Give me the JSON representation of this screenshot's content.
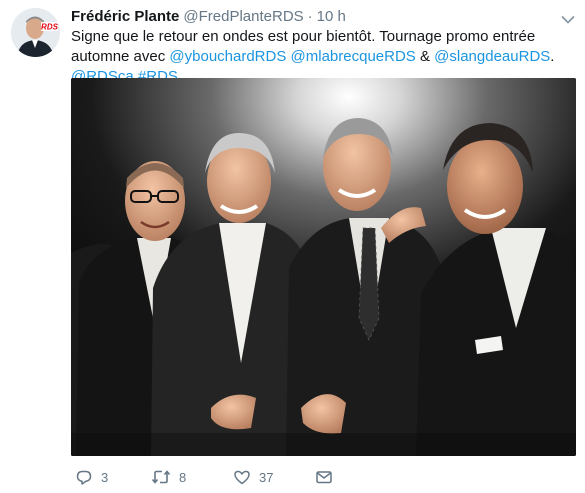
{
  "tweet": {
    "author_name": "Frédéric Plante",
    "handle": "@FredPlanteRDS",
    "separator": "·",
    "time": "10 h",
    "text_plain_1": "Signe que le retour en ondes est pour bientôt. Tournage promo entrée automne avec ",
    "mention_1": "@ybouchardRDS",
    "space": " ",
    "mention_2": "@mlabrecqueRDS",
    "amp": " & ",
    "mention_3": "@slangdeauRDS",
    "period": ". ",
    "mention_4": "@RDSca",
    "hashtag": "#RDS",
    "avatar_badge_text": "RDS"
  },
  "actions": {
    "reply_count": "3",
    "retweet_count": "8",
    "like_count": "37"
  },
  "icons": {
    "reply": "reply-icon",
    "retweet": "retweet-icon",
    "like": "heart-icon",
    "dm": "envelope-icon",
    "menu": "chevron-down-icon"
  },
  "colors": {
    "link": "#1b95e0",
    "muted": "#657786",
    "text": "#14171a",
    "rds_red": "#e30613"
  }
}
